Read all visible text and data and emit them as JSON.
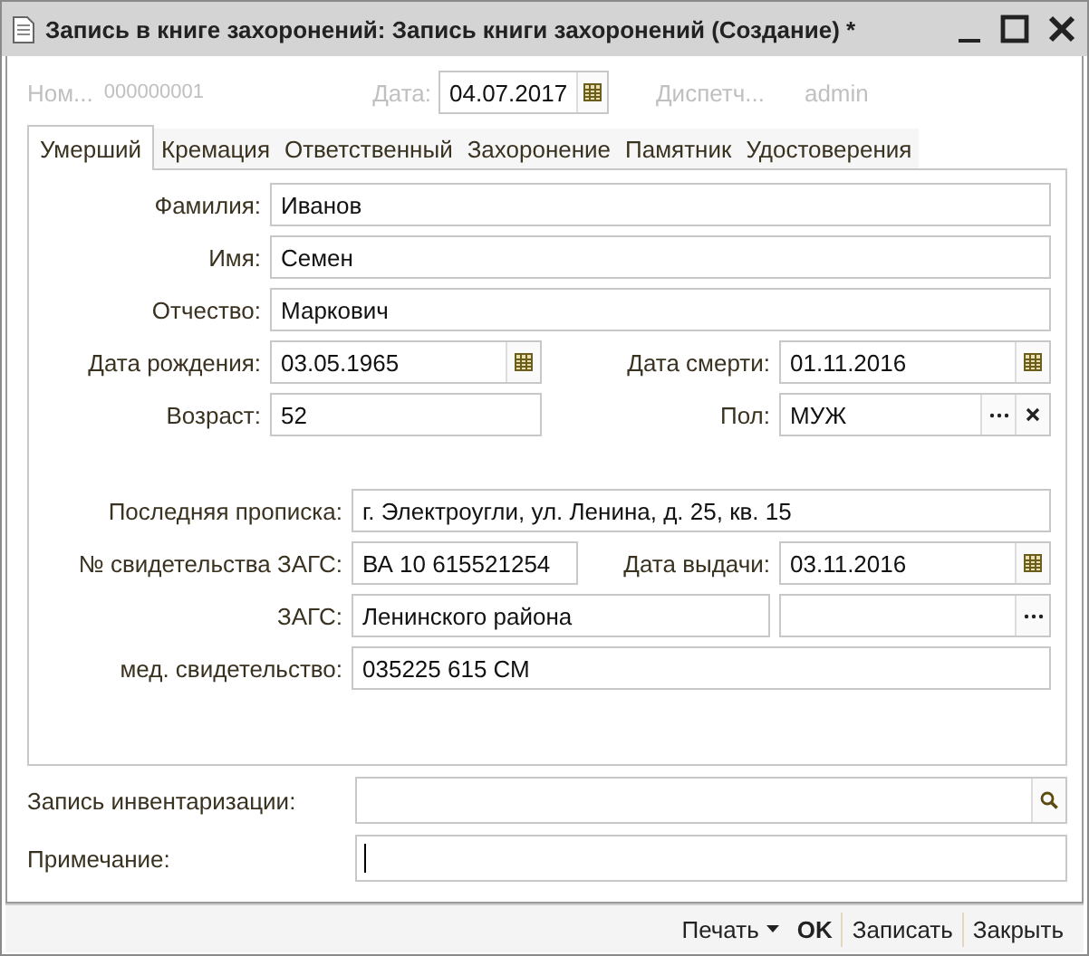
{
  "window": {
    "title": "Запись в книге захоронений: Запись книги захоронений (Создание) *"
  },
  "header": [
    {
      "label": "Ном...",
      "value": "000000001",
      "kind": "text",
      "disabled": true
    },
    {
      "label": "Дата:",
      "value": "04.07.2017",
      "kind": "date"
    },
    {
      "label": "Диспетч...",
      "value": "admin",
      "kind": "text",
      "disabled": true
    }
  ],
  "tabs": [
    {
      "label": "Умерший",
      "selected": true
    },
    {
      "label": "Кремация",
      "selected": false
    },
    {
      "label": "Ответственный",
      "selected": false
    },
    {
      "label": "Захоронение",
      "selected": false
    },
    {
      "label": "Памятник",
      "selected": false
    },
    {
      "label": "Удостоверения",
      "selected": false
    }
  ],
  "sections": [
    {
      "rows": [
        [
          {
            "kind": "text",
            "label": "Фамилия:",
            "value": "Иванов"
          }
        ],
        [
          {
            "kind": "text",
            "label": "Имя:",
            "value": "Семен"
          }
        ],
        [
          {
            "kind": "text",
            "label": "Отчество:",
            "value": "Маркович"
          }
        ],
        [
          {
            "kind": "date",
            "label": "Дата рождения:",
            "value": "03.05.1965"
          },
          {
            "kind": "date",
            "label": "Дата смерти:",
            "value": "01.11.2016"
          }
        ],
        [
          {
            "kind": "text",
            "label": "Возраст:",
            "value": "52"
          },
          {
            "kind": "choice",
            "label": "Пол:",
            "value": "МУЖ"
          }
        ]
      ]
    },
    {
      "rows": [
        [
          {
            "kind": "text",
            "label": "Последняя прописка:",
            "value": "г. Электроугли, ул. Ленина, д. 25, кв. 15"
          }
        ],
        [
          {
            "kind": "text",
            "label": "№ свидетельства ЗАГС:",
            "value": "ВА 10 615521254"
          },
          {
            "kind": "date",
            "label": "Дата выдачи:",
            "value": "03.11.2016"
          }
        ],
        [
          {
            "kind": "text",
            "label": "ЗАГС:",
            "value": "Ленинского района"
          },
          {
            "kind": "select"
          }
        ],
        [
          {
            "kind": "text",
            "label": "мед. свидетельство:",
            "value": "035225 615 СМ"
          }
        ]
      ]
    }
  ],
  "bottom": [
    {
      "kind": "search",
      "label": "Запись инвентаризации:"
    },
    {
      "kind": "focused",
      "label": "Примечание:"
    }
  ],
  "buttons": [
    {
      "label": "Печать",
      "kind": "menu"
    },
    {
      "label": "OK",
      "kind": "default"
    },
    {
      "label": "Записать",
      "kind": "plain"
    },
    {
      "label": "Закрыть",
      "kind": "plain"
    }
  ]
}
